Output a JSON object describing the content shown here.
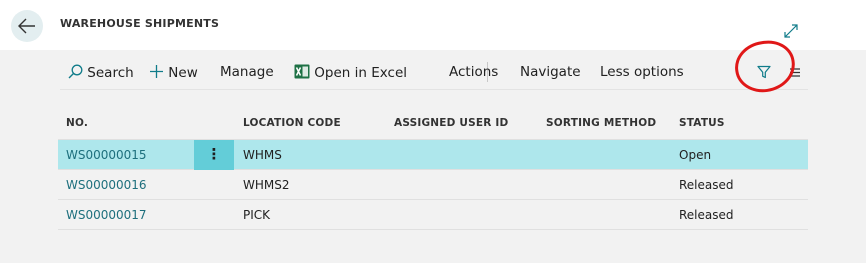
{
  "header": {
    "title": "WAREHOUSE SHIPMENTS"
  },
  "actions": {
    "search": "Search",
    "new": "New",
    "manage": "Manage",
    "open_in_excel": "Open in Excel",
    "actions": "Actions",
    "navigate": "Navigate",
    "less_options": "Less options"
  },
  "table": {
    "columns": [
      "NO.",
      "LOCATION CODE",
      "ASSIGNED USER ID",
      "SORTING METHOD",
      "STATUS"
    ],
    "rows": [
      {
        "no": "WS00000015",
        "location": "WHMS",
        "assigned_user": "",
        "sorting": "",
        "status": "Open"
      },
      {
        "no": "WS00000016",
        "location": "WHMS2",
        "assigned_user": "",
        "sorting": "",
        "status": "Released"
      },
      {
        "no": "WS00000017",
        "location": "PICK",
        "assigned_user": "",
        "sorting": "",
        "status": "Released"
      }
    ],
    "row_menu_glyph": "⋮"
  },
  "icons": {
    "back": "back-arrow-icon",
    "expand": "expand-icon",
    "search": "search-icon",
    "new": "plus-icon",
    "excel": "excel-icon",
    "filter": "filter-icon",
    "list": "list-icon"
  },
  "colors": {
    "selected_row": "#aee7ec",
    "row_menu": "#63cdd8",
    "link": "#1d6f7d",
    "annotation": "#e01818",
    "excel_green": "#1e7145",
    "accent": "#107c8a"
  }
}
